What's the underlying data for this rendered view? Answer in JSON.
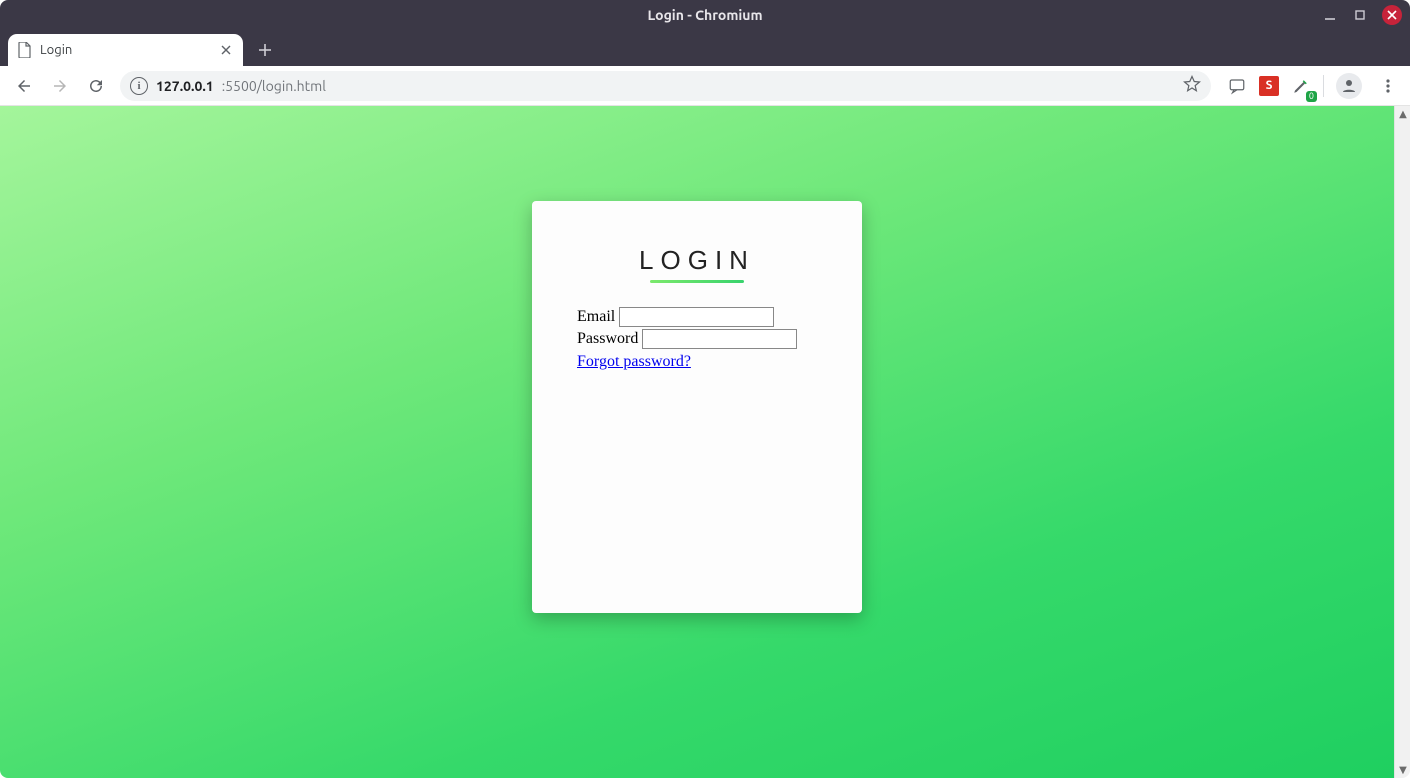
{
  "window": {
    "title": "Login - Chromium"
  },
  "tab": {
    "title": "Login"
  },
  "address": {
    "host": "127.0.0.1",
    "rest": ":5500/login.html"
  },
  "extensions": {
    "red_letter": "S",
    "badge_count": "0"
  },
  "login": {
    "heading": "LOGIN",
    "email_label": "Email",
    "password_label": "Password",
    "forgot": "Forgot password?"
  }
}
